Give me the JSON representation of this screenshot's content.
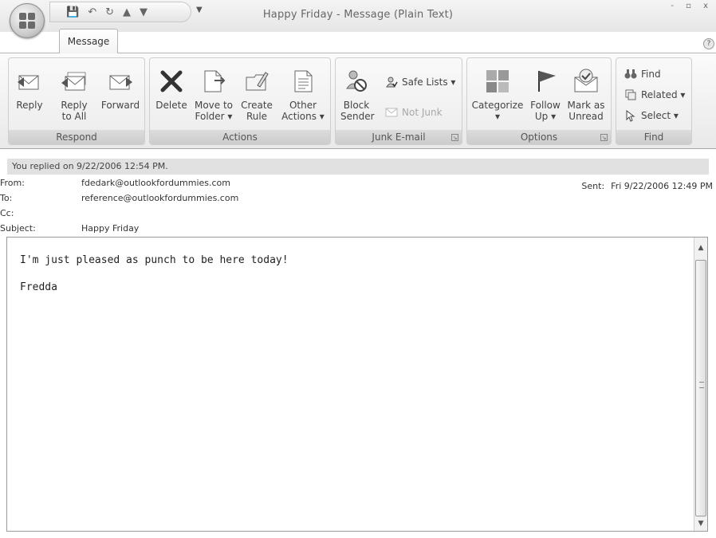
{
  "window": {
    "title": "Happy Friday - Message (Plain Text)",
    "controls": "- ▫ x",
    "help": "?"
  },
  "tabs": [
    {
      "label": "Message",
      "active": true
    }
  ],
  "ribbon": {
    "respond": {
      "label": "Respond",
      "reply": [
        "Reply",
        ""
      ],
      "reply_all": [
        "Reply",
        "to All"
      ],
      "forward": [
        "Forward",
        ""
      ]
    },
    "actions": {
      "label": "Actions",
      "delete": [
        "Delete",
        ""
      ],
      "move": [
        "Move to",
        "Folder ▾"
      ],
      "create_rule": [
        "Create",
        "Rule"
      ],
      "other_actions": [
        "Other",
        "Actions ▾"
      ]
    },
    "junk": {
      "label": "Junk E-mail",
      "block": [
        "Block",
        "Sender"
      ],
      "safe_lists": "Safe Lists ▾",
      "not_junk": "Not Junk"
    },
    "options": {
      "label": "Options",
      "categorize": [
        "Categorize",
        "▾"
      ],
      "follow_up": [
        "Follow",
        "Up ▾"
      ],
      "mark_unread": [
        "Mark as",
        "Unread"
      ]
    },
    "find": {
      "label": "Find",
      "find": "Find",
      "related": "Related ▾",
      "select": "Select ▾"
    }
  },
  "info_bar": "You replied on 9/22/2006 12:54 PM.",
  "headers": {
    "from_label": "From:",
    "from": "fdedark@outlookfordummies.com",
    "to_label": "To:",
    "to": "reference@outlookfordummies.com",
    "cc_label": "Cc:",
    "cc": "",
    "subject_label": "Subject:",
    "subject": "Happy Friday",
    "sent_label": "Sent:",
    "sent": "Fri 9/22/2006 12:49 PM"
  },
  "body": {
    "line1": "I'm just pleased as punch to be here today!",
    "line2": "",
    "line3": "Fredda"
  },
  "colors": {
    "ribbon_bg": "#ececec",
    "group_label": "#d4d4d4",
    "info_bar": "#e1e1e1"
  }
}
